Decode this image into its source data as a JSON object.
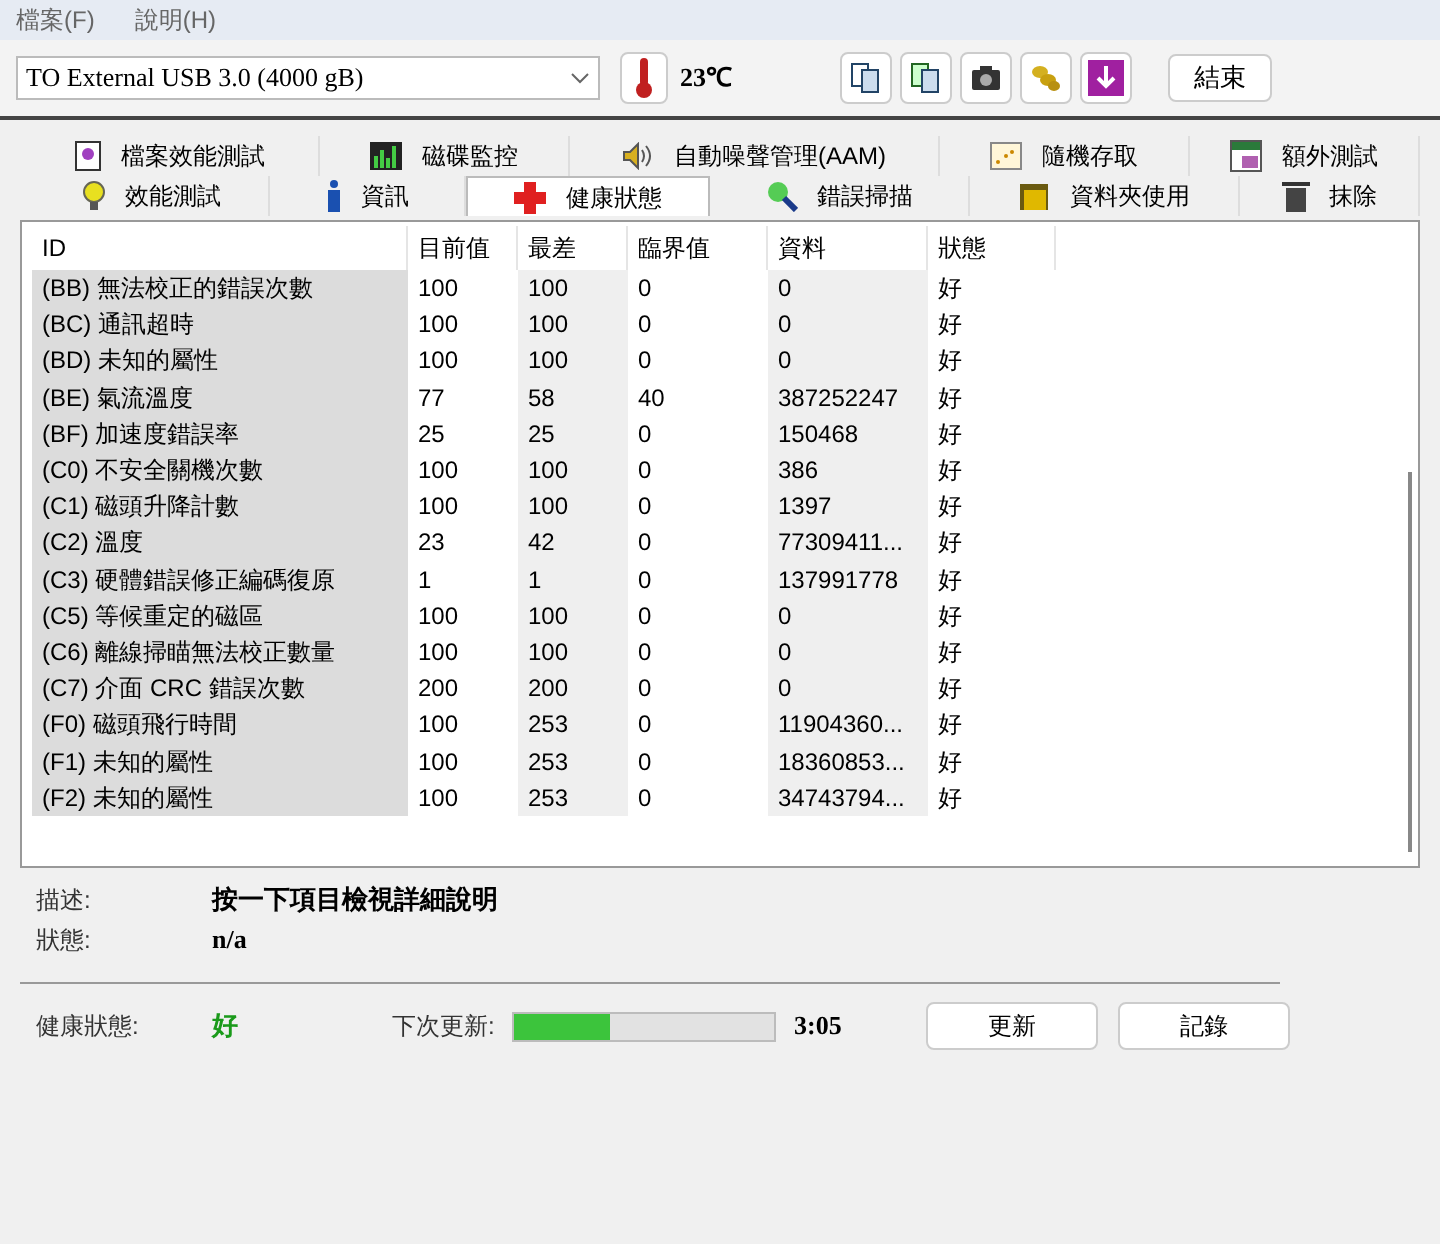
{
  "menu": [
    "檔案(F)",
    "說明(H)"
  ],
  "toolbar": {
    "drive": "TO External USB 3.0 (4000 gB)",
    "temperature": "23℃",
    "exit_button": "結束"
  },
  "tabs_back": [
    {
      "label": "檔案效能測試",
      "selected": false
    },
    {
      "label": "磁碟監控",
      "selected": false
    },
    {
      "label": "自動噪聲管理(AAM)",
      "selected": false
    },
    {
      "label": "隨機存取",
      "selected": false
    },
    {
      "label": "額外測試",
      "selected": false
    }
  ],
  "tabs_front": [
    {
      "label": "效能測試",
      "selected": false
    },
    {
      "label": "資訊",
      "selected": false
    },
    {
      "label": "健康狀態",
      "selected": true
    },
    {
      "label": "錯誤掃描",
      "selected": false
    },
    {
      "label": "資料夾使用",
      "selected": false
    },
    {
      "label": "抹除",
      "selected": false
    }
  ],
  "table": {
    "columns": [
      "ID",
      "目前值",
      "最差",
      "臨界值",
      "資料",
      "狀態"
    ],
    "rows": [
      [
        "(BB) 無法校正的錯誤次數",
        "100",
        "100",
        "0",
        "0",
        "好"
      ],
      [
        "(BC) 通訊超時",
        "100",
        "100",
        "0",
        "0",
        "好"
      ],
      [
        "(BD) 未知的屬性",
        "100",
        "100",
        "0",
        "0",
        "好"
      ],
      [
        "(BE) 氣流溫度",
        "77",
        "58",
        "40",
        "387252247",
        "好"
      ],
      [
        "(BF) 加速度錯誤率",
        "25",
        "25",
        "0",
        "150468",
        "好"
      ],
      [
        "(C0) 不安全關機次數",
        "100",
        "100",
        "0",
        "386",
        "好"
      ],
      [
        "(C1) 磁頭升降計數",
        "100",
        "100",
        "0",
        "1397",
        "好"
      ],
      [
        "(C2) 溫度",
        "23",
        "42",
        "0",
        "77309411...",
        "好"
      ],
      [
        "(C3) 硬體錯誤修正編碼復原",
        "1",
        "1",
        "0",
        "137991778",
        "好"
      ],
      [
        "(C5) 等候重定的磁區",
        "100",
        "100",
        "0",
        "0",
        "好"
      ],
      [
        "(C6) 離線掃瞄無法校正數量",
        "100",
        "100",
        "0",
        "0",
        "好"
      ],
      [
        "(C7) 介面 CRC 錯誤次數",
        "200",
        "200",
        "0",
        "0",
        "好"
      ],
      [
        "(F0) 磁頭飛行時間",
        "100",
        "253",
        "0",
        "11904360...",
        "好"
      ],
      [
        "(F1) 未知的屬性",
        "100",
        "253",
        "0",
        "18360853...",
        "好"
      ],
      [
        "(F2) 未知的屬性",
        "100",
        "253",
        "0",
        "34743794...",
        "好"
      ]
    ]
  },
  "details": {
    "description_label": "描述:",
    "description": "按一下項目檢視詳細說明",
    "status_label": "狀態:",
    "status": "n/a"
  },
  "health": {
    "label": "健康狀態:",
    "value": "好",
    "next_update_label": "下次更新:",
    "level": 0.37,
    "countdown": "3:05",
    "buttons": [
      "更新",
      "記錄"
    ]
  }
}
